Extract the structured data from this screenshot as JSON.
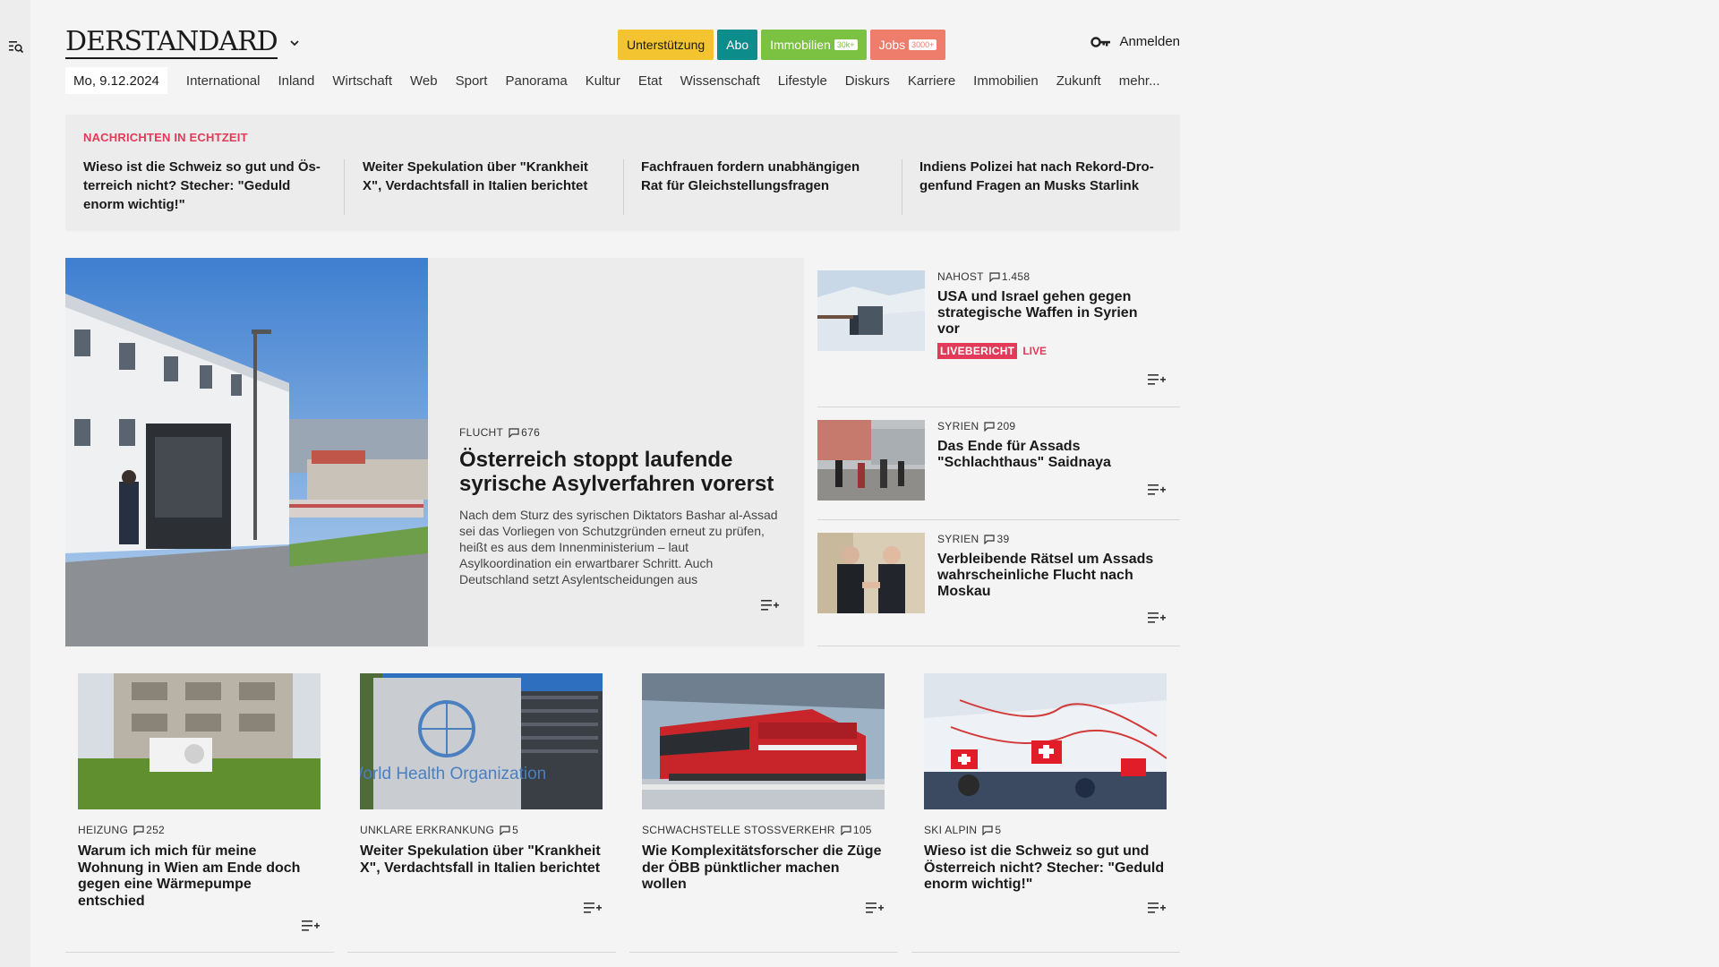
{
  "header": {
    "logo": "DERSTANDARD",
    "pills": [
      {
        "label": "Unterstützung"
      },
      {
        "label": "Abo"
      },
      {
        "label": "Immobilien",
        "badge": "30k+"
      },
      {
        "label": "Jobs",
        "badge": "3000+"
      }
    ],
    "login_label": "Anmelden"
  },
  "nav": {
    "date": "Mo, 9.12.2024",
    "items": [
      "International",
      "Inland",
      "Wirtschaft",
      "Web",
      "Sport",
      "Panorama",
      "Kultur",
      "Etat",
      "Wissenschaft",
      "Lifestyle",
      "Diskurs",
      "Karriere",
      "Immobilien",
      "Zukunft",
      "mehr..."
    ]
  },
  "ticker": {
    "label": "NACHRICHTEN IN ECHTZEIT",
    "items": [
      "Wieso ist die Schweiz so gut und Ös­terreich nicht? Stecher: \"Geduld enorm wichtig!\"",
      "Weiter Spekulation über \"Krankheit X\", Verdachtsfall in Italien berichtet",
      "Fachfrauen fordern unabhängigen Rat für Gleichstellungsfragen",
      "Indiens Polizei hat nach Rekord-Dro­genfund Fragen an Musks Starlink"
    ]
  },
  "hero": {
    "kicker": "FLUCHT",
    "comments": "676",
    "title": "Österreich stoppt laufende syrische Asylverfahren vorerst",
    "teaser": "Nach dem Sturz des syrischen Diktators Bashar al-Assad sei das Vorliegen von Schutzgründen erneut zu prüfen, heißt es aus dem Innenministerium – laut Asylkoordination ein erwartbarer Schritt. Auch Deutschland setzt Asylentscheidungen aus"
  },
  "side": [
    {
      "kicker": "NAHOST",
      "comments": "1.458",
      "title": "USA und Israel gehen gegen strategische Waffen in Syrien vor",
      "live_badge": "LIVEBERICHT",
      "live_text": "LIVE"
    },
    {
      "kicker": "SYRIEN",
      "comments": "209",
      "title": "Das Ende für Assads \"Schlachthaus\" Saidnaya"
    },
    {
      "kicker": "SYRIEN",
      "comments": "39",
      "title": "Verbleibende Rätsel um Assads wahrscheinliche Flucht nach Moskau"
    }
  ],
  "cards": [
    {
      "kicker": "HEIZUNG",
      "comments": "252",
      "title": "Warum ich mich für meine Wohnung in Wien am Ende doch gegen eine Wärmepumpe entschied"
    },
    {
      "kicker": "UNKLARE ERKRANKUNG",
      "comments": "5",
      "title": "Weiter Spekulation über \"Krankheit X\", Verdachtsfall in Italien berichtet",
      "image_text": "World Health Organization"
    },
    {
      "kicker": "SCHWACHSTELLE STOSSVERKEHR",
      "comments": "105",
      "title": "Wie Komplexitätsforscher die Züge der ÖBB pünktlicher machen wollen"
    },
    {
      "kicker": "SKI ALPIN",
      "comments": "5",
      "title": "Wieso ist die Schweiz so gut und Österreich nicht? Stecher: \"Geduld enorm wichtig!\""
    }
  ],
  "colors": {
    "accent_red": "#e23a58",
    "support_yellow": "#f4c430",
    "abo_teal": "#0d8c8c",
    "immo_green": "#7cc242",
    "jobs_salmon": "#ef7d6b"
  }
}
